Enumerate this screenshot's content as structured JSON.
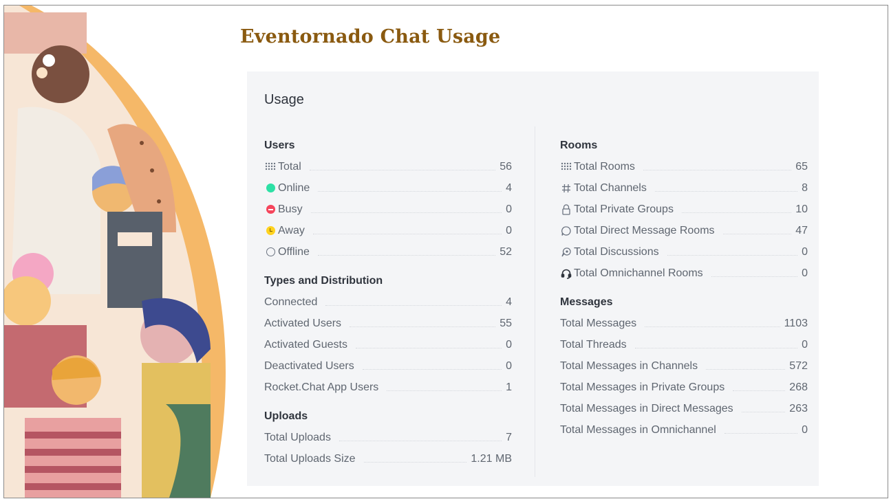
{
  "page": {
    "title": "Eventornado Chat Usage"
  },
  "card": {
    "title": "Usage"
  },
  "users": {
    "heading": "Users",
    "rows": [
      {
        "icon": "users-grid-icon",
        "label": "Total",
        "value": "56"
      },
      {
        "icon": "online-status-icon",
        "label": "Online",
        "value": "4"
      },
      {
        "icon": "busy-status-icon",
        "label": "Busy",
        "value": "0"
      },
      {
        "icon": "away-status-icon",
        "label": "Away",
        "value": "0"
      },
      {
        "icon": "offline-status-icon",
        "label": "Offline",
        "value": "52"
      }
    ]
  },
  "types": {
    "heading": "Types and Distribution",
    "rows": [
      {
        "label": "Connected",
        "value": "4"
      },
      {
        "label": "Activated Users",
        "value": "55"
      },
      {
        "label": "Activated Guests",
        "value": "0"
      },
      {
        "label": "Deactivated Users",
        "value": "0"
      },
      {
        "label": "Rocket.Chat App Users",
        "value": "1"
      }
    ]
  },
  "uploads": {
    "heading": "Uploads",
    "rows": [
      {
        "label": "Total Uploads",
        "value": "7"
      },
      {
        "label": "Total Uploads Size",
        "value": "1.21 MB"
      }
    ]
  },
  "rooms": {
    "heading": "Rooms",
    "rows": [
      {
        "icon": "rooms-grid-icon",
        "label": "Total Rooms",
        "value": "65"
      },
      {
        "icon": "hash-icon",
        "label": "Total Channels",
        "value": "8"
      },
      {
        "icon": "lock-icon",
        "label": "Total Private Groups",
        "value": "10"
      },
      {
        "icon": "chat-bubble-icon",
        "label": "Total Direct Message Rooms",
        "value": "47"
      },
      {
        "icon": "discussion-icon",
        "label": "Total Discussions",
        "value": "0"
      },
      {
        "icon": "headset-icon",
        "label": "Total Omnichannel Rooms",
        "value": "0"
      }
    ]
  },
  "messages": {
    "heading": "Messages",
    "rows": [
      {
        "label": "Total Messages",
        "value": "1103"
      },
      {
        "label": "Total Threads",
        "value": "0"
      },
      {
        "label": "Total Messages in Channels",
        "value": "572"
      },
      {
        "label": "Total Messages in Private Groups",
        "value": "268"
      },
      {
        "label": "Total Messages in Direct Messages",
        "value": "263"
      },
      {
        "label": "Total Messages in Omnichannel",
        "value": "0"
      }
    ]
  },
  "colors": {
    "title": "#8a5a10",
    "online": "#2de0a5",
    "busy": "#f5455c",
    "away": "#ffd21f",
    "card_bg": "#f4f5f7",
    "illustration_arc": "#f5b868"
  }
}
